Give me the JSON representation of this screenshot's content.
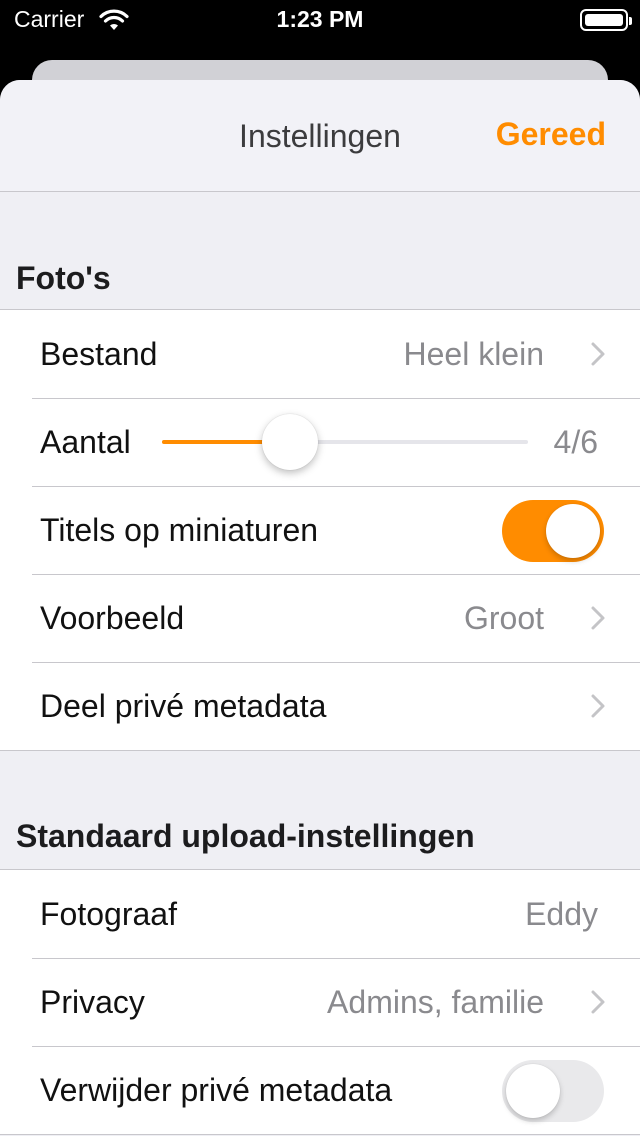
{
  "status_bar": {
    "carrier": "Carrier",
    "time": "1:23 PM"
  },
  "nav": {
    "title": "Instellingen",
    "done_label": "Gereed"
  },
  "colors": {
    "accent": "#ff8c00",
    "background": "#efeff4",
    "separator": "#c8c7cc",
    "secondary_text": "#8a8a8e"
  },
  "sections": {
    "photos": {
      "header": "Foto's",
      "file": {
        "label": "Bestand",
        "value": "Heel klein"
      },
      "count": {
        "label": "Aantal",
        "value": "4/6",
        "level": 0.35
      },
      "titles": {
        "label": "Titels op miniaturen",
        "on": true
      },
      "preview": {
        "label": "Voorbeeld",
        "value": "Groot"
      },
      "share_meta": {
        "label": "Deel privé metadata"
      }
    },
    "upload": {
      "header": "Standaard upload-instellingen",
      "photographer": {
        "label": "Fotograaf",
        "value": "Eddy"
      },
      "privacy": {
        "label": "Privacy",
        "value": "Admins, familie"
      },
      "strip_meta": {
        "label": "Verwijder privé metadata",
        "on": false
      }
    }
  },
  "icons": {
    "wifi": "wifi-icon",
    "battery": "battery-icon",
    "chevron": "chevron-right-icon"
  }
}
